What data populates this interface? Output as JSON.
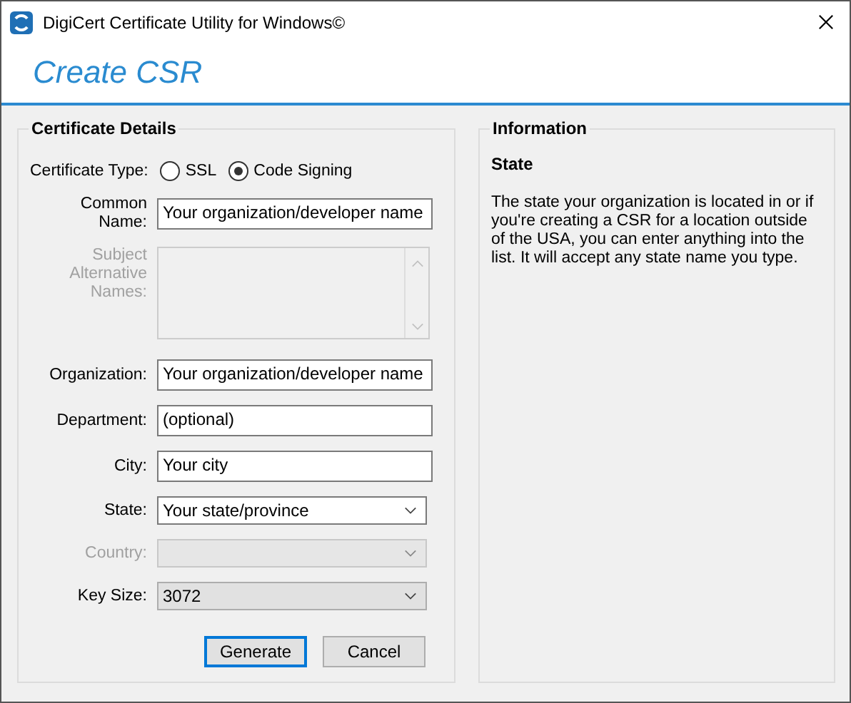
{
  "window": {
    "title": "DigiCert Certificate Utility for Windows©"
  },
  "header": {
    "title": "Create CSR"
  },
  "details": {
    "title": "Certificate Details",
    "type_label": "Certificate Type:",
    "types": [
      {
        "label": "SSL",
        "selected": false
      },
      {
        "label": "Code Signing",
        "selected": true
      }
    ],
    "fields": [
      {
        "kind": "text",
        "label": "Common Name:",
        "value": "Your organization/developer name",
        "disabled": false
      },
      {
        "kind": "textarea",
        "label": "Subject Alternative Names:",
        "disabled": true
      },
      {
        "kind": "text",
        "label": "Organization:",
        "value": "Your organization/developer name",
        "disabled": false
      },
      {
        "kind": "text",
        "label": "Department:",
        "value": "(optional)",
        "disabled": false
      },
      {
        "kind": "text",
        "label": "City:",
        "value": "Your city",
        "disabled": false
      },
      {
        "kind": "dropdown",
        "label": "State:",
        "value": "Your state/province",
        "editable": true,
        "disabled": false
      },
      {
        "kind": "dropdown",
        "label": "Country:",
        "editable": false,
        "disabled": true
      },
      {
        "kind": "dropdown",
        "label": "Key Size:",
        "value": "3072",
        "editable": false,
        "disabled": false
      }
    ],
    "buttons": [
      {
        "label": "Generate",
        "default": true
      },
      {
        "label": "Cancel",
        "default": false
      }
    ]
  },
  "information": {
    "title": "Information",
    "heading": "State",
    "text": "The state your organization is located in or if you're creating a CSR for a location outside of the USA, you can enter anything into the list. It will accept any state name you type."
  }
}
